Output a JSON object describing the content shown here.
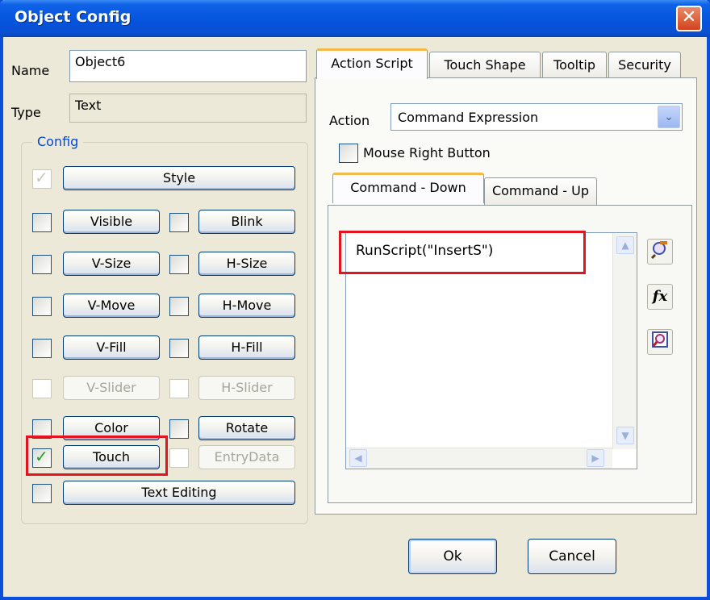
{
  "window": {
    "title": "Object Config"
  },
  "name": {
    "label": "Name",
    "value": "Object6"
  },
  "type": {
    "label": "Type",
    "value": "Text"
  },
  "config": {
    "legend": "Config",
    "style_label": "Style",
    "left_column": [
      {
        "label": "Visible",
        "checked": false,
        "enabled": true
      },
      {
        "label": "V-Size",
        "checked": false,
        "enabled": true
      },
      {
        "label": "V-Move",
        "checked": false,
        "enabled": true
      },
      {
        "label": "V-Fill",
        "checked": false,
        "enabled": true
      },
      {
        "label": "V-Slider",
        "checked": false,
        "enabled": false
      },
      {
        "label": "Color",
        "checked": false,
        "enabled": true
      },
      {
        "label": "Touch",
        "checked": true,
        "enabled": true
      }
    ],
    "right_column": [
      {
        "label": "Blink",
        "checked": false,
        "enabled": true
      },
      {
        "label": "H-Size",
        "checked": false,
        "enabled": true
      },
      {
        "label": "H-Move",
        "checked": false,
        "enabled": true
      },
      {
        "label": "H-Fill",
        "checked": false,
        "enabled": true
      },
      {
        "label": "H-Slider",
        "checked": false,
        "enabled": false
      },
      {
        "label": "Rotate",
        "checked": false,
        "enabled": true
      },
      {
        "label": "EntryData",
        "checked": false,
        "enabled": false
      }
    ],
    "text_editing_label": "Text Editing"
  },
  "tabs": [
    "Action Script",
    "Touch Shape",
    "Tooltip",
    "Security"
  ],
  "action": {
    "label": "Action",
    "selected": "Command Expression",
    "mouse_right_label": "Mouse Right Button"
  },
  "command_tabs": [
    "Command - Down",
    "Command - Up"
  ],
  "script": {
    "text": "RunScript(\"InsertS\")"
  },
  "icons": [
    "search-icon",
    "function-icon",
    "zoom-icon"
  ],
  "buttons": {
    "ok": "Ok",
    "cancel": "Cancel"
  },
  "colors": {
    "titlebar": "#0553dc",
    "highlight": "#e2141f"
  }
}
